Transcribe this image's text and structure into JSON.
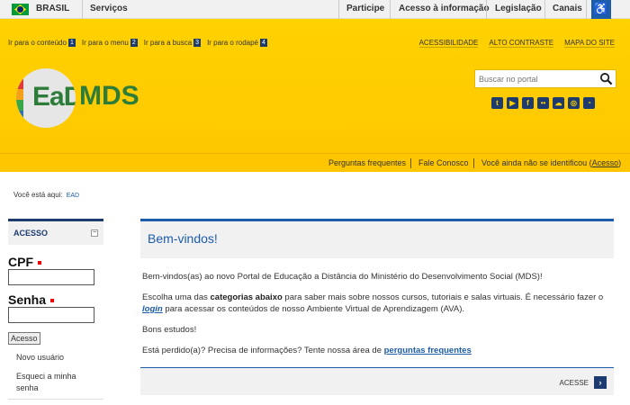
{
  "govbar": {
    "country": "BRASIL",
    "services": "Serviços",
    "items": [
      "Participe",
      "Acesso à informação",
      "Legislação",
      "Canais"
    ]
  },
  "header": {
    "skip_links": [
      {
        "label": "Ir para o conteúdo",
        "num": "1"
      },
      {
        "label": "Ir para o menu",
        "num": "2"
      },
      {
        "label": "Ir para a busca",
        "num": "3"
      },
      {
        "label": "Ir para o rodapé",
        "num": "4"
      }
    ],
    "top_links": [
      "ACESSIBILIDADE",
      "ALTO CONTRASTE",
      "MAPA DO SITE"
    ],
    "logo_ead": "EaD",
    "logo_mds": "MDS",
    "search_placeholder": "Buscar no portal",
    "socials": [
      "twitter-icon",
      "youtube-icon",
      "facebook-icon",
      "flickr-icon",
      "soundcloud-icon",
      "instagram-icon",
      "rss-icon"
    ]
  },
  "subbar": {
    "faq": "Perguntas frequentes",
    "contact": "Fale Conosco",
    "ident_pre": "Você ainda não se identificou (",
    "ident_link": "Acesso",
    "ident_post": ")"
  },
  "breadcrumb": {
    "label": "Você está aqui:",
    "item": "EAD"
  },
  "sidebar": {
    "title": "ACESSO",
    "minimize": "−",
    "cpf_label": "CPF",
    "password_label": "Senha",
    "submit": "Acesso",
    "new_user": "Novo usuário",
    "forgot": "Esqueci a minha senha"
  },
  "main": {
    "title": "Bem-vindos!",
    "p1": "Bem-vindos(as) ao novo Portal de Educação a Distância do Ministério do Desenvolvimento Social (MDS)!",
    "p2_a": "Escolha uma das ",
    "p2_b": "categorias abaixo",
    "p2_c": " para saber mais sobre nossos cursos, tutoriais e salas virtuais. É necessário fazer o ",
    "p2_link": "login",
    "p2_d": " para acessar os conteúdos de nosso Ambiente Virtual de Aprendizagem (AVA).",
    "p3": "Bons estudos!",
    "p4_a": "Está perdido(a)? Precisa de informações? Tente nossa área de ",
    "p4_link": "perguntas frequentes",
    "footer_link": "ACESSE",
    "footer_arrow": "›"
  },
  "colors": {
    "yellow": "#ffd200",
    "navy": "#1d3b6e",
    "blue": "#1c5ca8",
    "green": "#2d7c3a"
  }
}
